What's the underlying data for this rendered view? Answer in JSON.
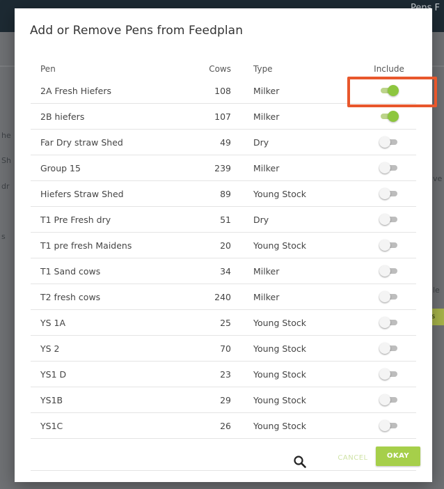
{
  "background": {
    "topbar_text": "Pens F",
    "fragments": [
      "he",
      "Sh",
      "dr",
      "s",
      "ve",
      "le",
      "s"
    ]
  },
  "dialog": {
    "title": "Add or Remove Pens from Feedplan",
    "columns": {
      "pen": "Pen",
      "cows": "Cows",
      "type": "Type",
      "include": "Include"
    },
    "rows": [
      {
        "pen": "2A Fresh Hiefers",
        "cows": "108",
        "type": "Milker",
        "include": true
      },
      {
        "pen": "2B hiefers",
        "cows": "107",
        "type": "Milker",
        "include": true
      },
      {
        "pen": "Far Dry straw Shed",
        "cows": "49",
        "type": "Dry",
        "include": false
      },
      {
        "pen": "Group 15",
        "cows": "239",
        "type": "Milker",
        "include": false
      },
      {
        "pen": "Hiefers Straw Shed",
        "cows": "89",
        "type": "Young Stock",
        "include": false
      },
      {
        "pen": "T1 Pre Fresh dry",
        "cows": "51",
        "type": "Dry",
        "include": false
      },
      {
        "pen": "T1 pre fresh Maidens",
        "cows": "20",
        "type": "Young Stock",
        "include": false
      },
      {
        "pen": "T1 Sand cows",
        "cows": "34",
        "type": "Milker",
        "include": false
      },
      {
        "pen": "T2 fresh cows",
        "cows": "240",
        "type": "Milker",
        "include": false
      },
      {
        "pen": "YS 1A",
        "cows": "25",
        "type": "Young Stock",
        "include": false
      },
      {
        "pen": "YS 2",
        "cows": "70",
        "type": "Young Stock",
        "include": false
      },
      {
        "pen": "YS1 D",
        "cows": "23",
        "type": "Young Stock",
        "include": false
      },
      {
        "pen": "YS1B",
        "cows": "29",
        "type": "Young Stock",
        "include": false
      },
      {
        "pen": "YS1C",
        "cows": "26",
        "type": "Young Stock",
        "include": false
      }
    ],
    "buttons": {
      "cancel": "CANCEL",
      "okay": "OKAY"
    },
    "icons": {
      "search": "search-icon"
    },
    "colors": {
      "accent": "#8dc63f",
      "highlight": "#e8572c"
    }
  }
}
